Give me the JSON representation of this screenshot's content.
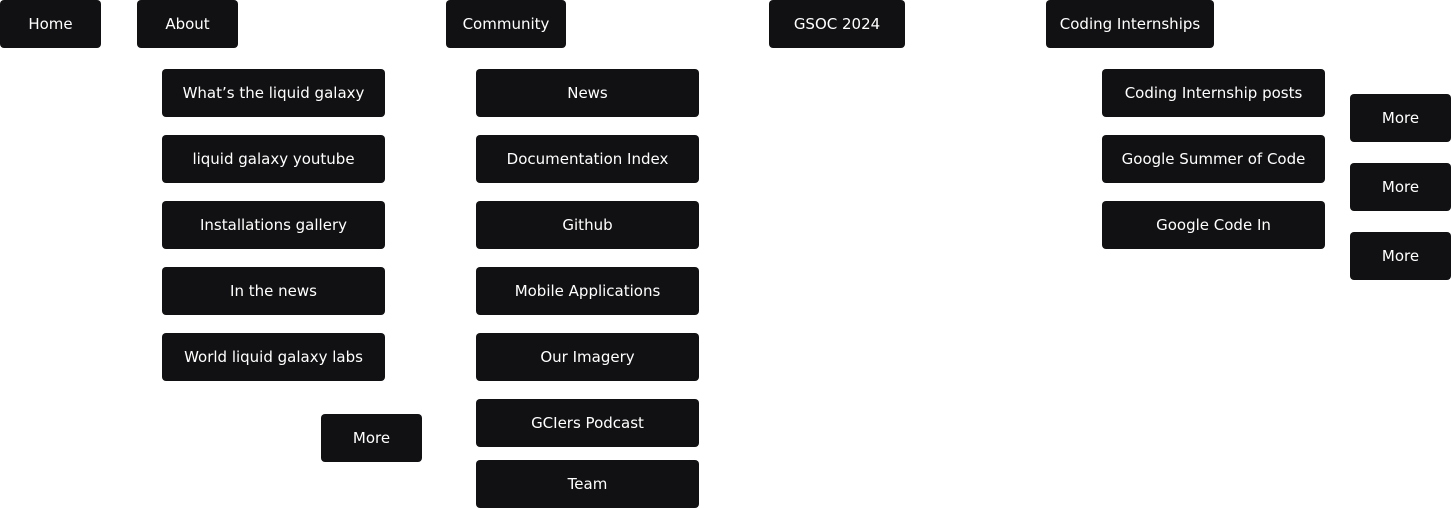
{
  "nav": {
    "home": "Home",
    "about": "About",
    "community": "Community",
    "gsoc": "GSOC 2024",
    "coding": "Coding Internships"
  },
  "about_menu": {
    "items": [
      "What’s the liquid galaxy",
      "liquid galaxy youtube",
      "Installations gallery",
      "In the news",
      "World liquid galaxy labs"
    ],
    "more": "More"
  },
  "community_menu": {
    "items": [
      "News",
      "Documentation Index",
      "Github",
      "Mobile Applications",
      "Our Imagery",
      "GCIers Podcast",
      "Team"
    ]
  },
  "coding_menu": {
    "items": [
      "Coding Internship posts",
      "Google Summer of Code",
      "Google Code In"
    ],
    "more": [
      "More",
      "More",
      "More"
    ]
  }
}
